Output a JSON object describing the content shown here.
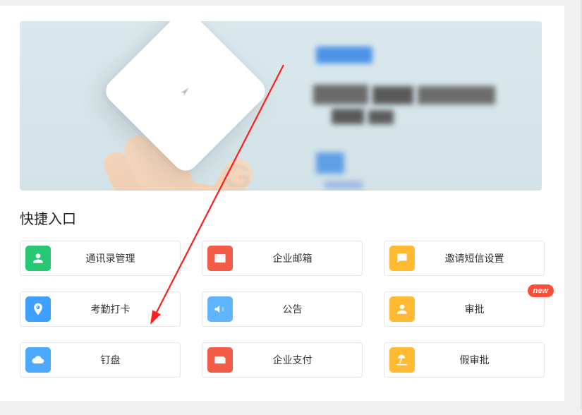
{
  "section_title": "快捷入口",
  "badge_new": "new",
  "entries": [
    {
      "label": "通讯录管理",
      "color": "#28c774"
    },
    {
      "label": "企业邮箱",
      "color": "#f25b45"
    },
    {
      "label": "邀请短信设置",
      "color": "#ffb933"
    },
    {
      "label": "考勤打卡",
      "color": "#3fa0ff"
    },
    {
      "label": "公告",
      "color": "#5fb6ff"
    },
    {
      "label": "审批",
      "color": "#ffb933",
      "badge": "new"
    },
    {
      "label": "钉盘",
      "color": "#4aa9ff"
    },
    {
      "label": "企业支付",
      "color": "#f25b45"
    },
    {
      "label": "假审批",
      "color": "#ffb933"
    }
  ]
}
